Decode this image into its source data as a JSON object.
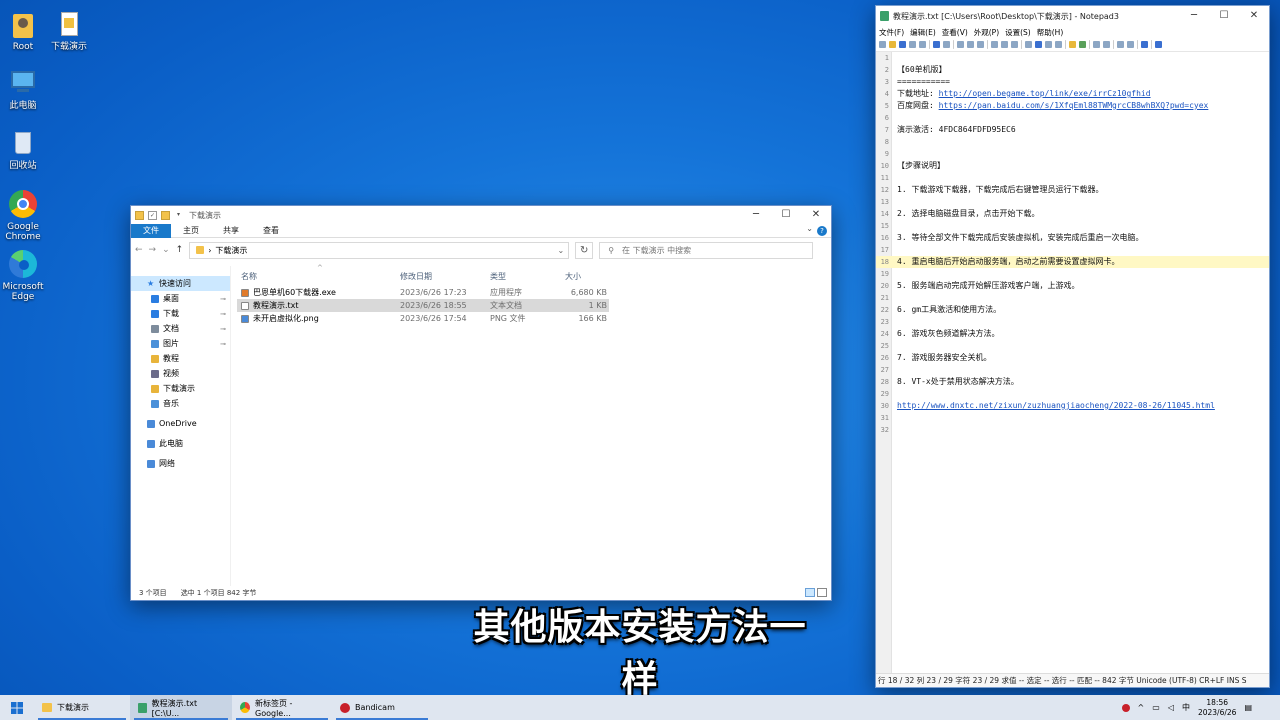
{
  "desktop": {
    "icons": [
      "Root",
      "下载演示",
      "此电脑",
      "回收站",
      "Google Chrome",
      "Microsoft Edge"
    ]
  },
  "explorer": {
    "title": "下载演示",
    "ribbon": [
      "文件",
      "主页",
      "共享",
      "查看"
    ],
    "address": "下载演示",
    "search_placeholder": "在 下载演示 中搜索",
    "sidebar": [
      {
        "label": "快速访问",
        "type": "head"
      },
      {
        "label": "桌面",
        "pin": true,
        "color": "#2a7de1"
      },
      {
        "label": "下载",
        "pin": true,
        "color": "#2a7de1"
      },
      {
        "label": "文档",
        "pin": true,
        "color": "#7e8c9c"
      },
      {
        "label": "图片",
        "pin": true,
        "color": "#4a90d9"
      },
      {
        "label": "教程",
        "color": "#e8b43a"
      },
      {
        "label": "视频",
        "color": "#6b6b8a"
      },
      {
        "label": "下载演示",
        "color": "#e8b43a"
      },
      {
        "label": "音乐",
        "color": "#4a90d9"
      },
      {
        "label": "OneDrive",
        "type": "head"
      },
      {
        "label": "此电脑",
        "type": "head"
      },
      {
        "label": "网络",
        "type": "head"
      }
    ],
    "columns": {
      "name": "名称",
      "date": "修改日期",
      "type": "类型",
      "size": "大小"
    },
    "files": [
      {
        "name": "巴恩单机60下载器.exe",
        "date": "2023/6/26 17:23",
        "type": "应用程序",
        "size": "6,680 KB"
      },
      {
        "name": "教程演示.txt",
        "date": "2023/6/26 18:55",
        "type": "文本文档",
        "size": "1 KB"
      },
      {
        "name": "未开启虚拟化.png",
        "date": "2023/6/26 17:54",
        "type": "PNG 文件",
        "size": "166 KB"
      }
    ],
    "status": {
      "count": "3 个项目",
      "selected": "选中 1 个项目  842 字节"
    }
  },
  "notepad": {
    "title": "教程演示.txt [C:\\Users\\Root\\Desktop\\下载演示] - Notepad3",
    "menu": [
      "文件(F)",
      "编辑(E)",
      "查看(V)",
      "外观(P)",
      "设置(S)",
      "帮助(H)"
    ],
    "lines": [
      "",
      "【60单机版】",
      "===========",
      "下载地址: http://open.begame.top/link/exe/irrCz10gfhid",
      "百度网盘: https://pan.baidu.com/s/1XfqEml88TWMgrcCB8whBXQ?pwd=cyex",
      "",
      "演示激活: 4FDC864FDFD95EC6",
      "",
      "",
      "【步骤说明】",
      "",
      "1. 下载游戏下载器，下载完成后右键管理员运行下载器。",
      "",
      "2. 选择电脑磁盘目录，点击开始下载。",
      "",
      "3. 等待全部文件下载完成后安装虚拟机，安装完成后重启一次电脑。",
      "",
      "4. 重启电脑后开始启动服务端，启动之前需要设置虚拟网卡。",
      "",
      "5. 服务端启动完成开始解压游戏客户端，上游戏。",
      "",
      "6. gm工具激活和使用方法。",
      "",
      "6. 游戏灰色频道解决方法。",
      "",
      "7. 游戏服务器安全关机。",
      "",
      "8. VT-x处于禁用状态解决方法。",
      "",
      "http://www.dnxtc.net/zixun/zuzhuangjiaocheng/2022-08-26/11045.html",
      "",
      ""
    ],
    "current_line": 18,
    "status": "行 18 / 32  列 23 / 29  字符 23 / 29  求值 --  选定 --  选行 --  匹配 --  842 字节  Unicode (UTF-8)  CR+LF  INS  S"
  },
  "caption": "其他版本安装方法一样",
  "taskbar": {
    "apps": [
      "下载演示",
      "教程演示.txt [C:\\U...",
      "新标签页 - Google...",
      "Bandicam"
    ],
    "time": "18:56",
    "date": "2023/6/26",
    "ime": "中"
  }
}
